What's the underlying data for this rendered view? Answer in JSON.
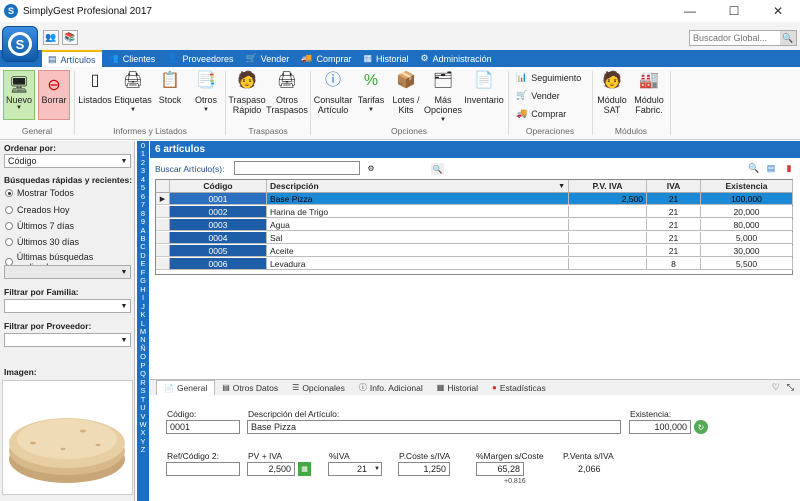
{
  "window": {
    "title": "SimplyGest Profesional 2017",
    "minimize": "—",
    "maximize": "☐",
    "close": "✕"
  },
  "global_search": {
    "placeholder": "Buscador Global..."
  },
  "tabs": [
    {
      "label": "Artículos"
    },
    {
      "label": "Clientes"
    },
    {
      "label": "Proveedores"
    },
    {
      "label": "Vender"
    },
    {
      "label": "Comprar"
    },
    {
      "label": "Historial"
    },
    {
      "label": "Administración"
    }
  ],
  "ribbon": {
    "nuevo": "Nuevo",
    "borrar": "Borrar",
    "group_general": "General",
    "listados": "Listados",
    "etiquetas": "Etiquetas",
    "stock": "Stock",
    "otros": "Otros",
    "group_informes": "Informes y Listados",
    "traspaso_rapido": [
      "Traspaso",
      "Rápido"
    ],
    "otros_traspasos": [
      "Otros",
      "Traspasos"
    ],
    "group_traspasos": "Traspasos",
    "consultar": [
      "Consultar",
      "Artículo"
    ],
    "tarifas": "Tarifas",
    "lotes": [
      "Lotes /",
      "Kits"
    ],
    "mas_opciones": [
      "Más",
      "Opciones"
    ],
    "inventario": "Inventario",
    "group_opciones": "Opciones",
    "seguimiento": "Seguimiento",
    "vender": "Vender",
    "comprar": "Comprar",
    "group_operaciones": "Operaciones",
    "modulo_sat": [
      "Módulo",
      "SAT"
    ],
    "modulo_fabric": [
      "Módulo",
      "Fabric."
    ],
    "group_modulos": "Módulos"
  },
  "left": {
    "ordenar_label": "Ordenar por:",
    "ordenar_value": "Código",
    "busquedas_label": "Búsquedas rápidas y recientes:",
    "radios": [
      "Mostrar Todos",
      "Creados Hoy",
      "Últimos 7 días",
      "Últimos 30 días",
      "Últimas búsquedas realizadas:"
    ],
    "familia_label": "Filtrar por Familia:",
    "proveedor_label": "Filtrar por Proveedor:",
    "imagen_label": "Imagen:"
  },
  "alpha": [
    "0",
    "1",
    "2",
    "3",
    "4",
    "5",
    "6",
    "7",
    "8",
    "9",
    "A",
    "B",
    "C",
    "D",
    "E",
    "F",
    "G",
    "H",
    "I",
    "J",
    "K",
    "L",
    "M",
    "N",
    "Ñ",
    "O",
    "P",
    "Q",
    "R",
    "S",
    "T",
    "U",
    "V",
    "W",
    "X",
    "Y",
    "Z"
  ],
  "main": {
    "header": "6 artículos",
    "search_label": "Buscar Artículo(s):",
    "columns": [
      "Código",
      "Descripción",
      "P.V. IVA",
      "IVA",
      "Existencia"
    ],
    "rows": [
      {
        "codigo": "0001",
        "descripcion": "Base Pizza",
        "pv": "2,500",
        "iva": "21",
        "existencia": "100,000"
      },
      {
        "codigo": "0002",
        "descripcion": "Harina de Trigo",
        "pv": "",
        "iva": "21",
        "existencia": "20,000"
      },
      {
        "codigo": "0003",
        "descripcion": "Agua",
        "pv": "",
        "iva": "21",
        "existencia": "80,000"
      },
      {
        "codigo": "0004",
        "descripcion": "Sal",
        "pv": "",
        "iva": "21",
        "existencia": "5,000"
      },
      {
        "codigo": "0005",
        "descripcion": "Aceite",
        "pv": "",
        "iva": "21",
        "existencia": "30,000"
      },
      {
        "codigo": "0006",
        "descripcion": "Levadura",
        "pv": "",
        "iva": "8",
        "existencia": "5,500"
      }
    ]
  },
  "detail_tabs": [
    "General",
    "Otros Datos",
    "Opcionales",
    "Info. Adicional",
    "Historial",
    "Estadísticas"
  ],
  "detail": {
    "codigo_label": "Código:",
    "codigo": "0001",
    "desc_label": "Descripción del Artículo:",
    "descripcion": "Base Pizza",
    "existencia_label": "Existencia:",
    "existencia": "100,000",
    "ref_label": "Ref/Código 2:",
    "ref": "",
    "pv_label": "PV + IVA",
    "pv": "2,500",
    "iva_label": "%IVA",
    "iva": "21",
    "pcoste_label": "P.Coste s/IVA",
    "pcoste": "1,250",
    "margen_label": "%Margen s/Coste",
    "margen": "65,28",
    "margen_sub": "+0.816",
    "pventa_label": "P.Venta s/IVA",
    "pventa": "2,066"
  }
}
